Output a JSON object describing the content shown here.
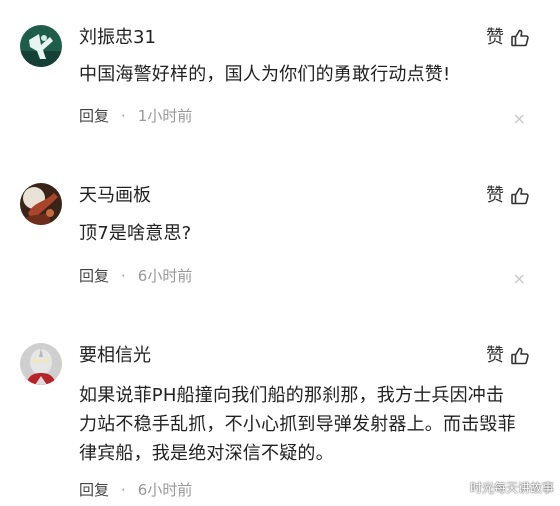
{
  "comments": [
    {
      "username": "刘振忠31",
      "like_label": "赞",
      "content": "中国海警好样的，国人为你们的勇敢行动点赞!",
      "reply_label": "回复",
      "separator": "·",
      "time": "1小时前",
      "close_glyph": "×"
    },
    {
      "username": "天马画板",
      "like_label": "赞",
      "content": "顶7是啥意思?",
      "reply_label": "回复",
      "separator": "·",
      "time": "6小时前",
      "close_glyph": "×"
    },
    {
      "username": "要相信光",
      "like_label": "赞",
      "content": "如果说菲PH船撞向我们船的那刹那，我方士兵因冲击力站不稳手乱抓，不小心抓到导弹发射器上。而击毁菲律宾船，我是绝对深信不疑的。",
      "reply_label": "回复",
      "separator": "·",
      "time": "6小时前"
    }
  ],
  "watermark": "时光每天讲故事",
  "icons": {
    "like": "thumbs-up-icon",
    "dismiss": "close-icon"
  },
  "colors": {
    "text": "#222222",
    "meta": "#999999",
    "close": "#c8c8c8"
  }
}
